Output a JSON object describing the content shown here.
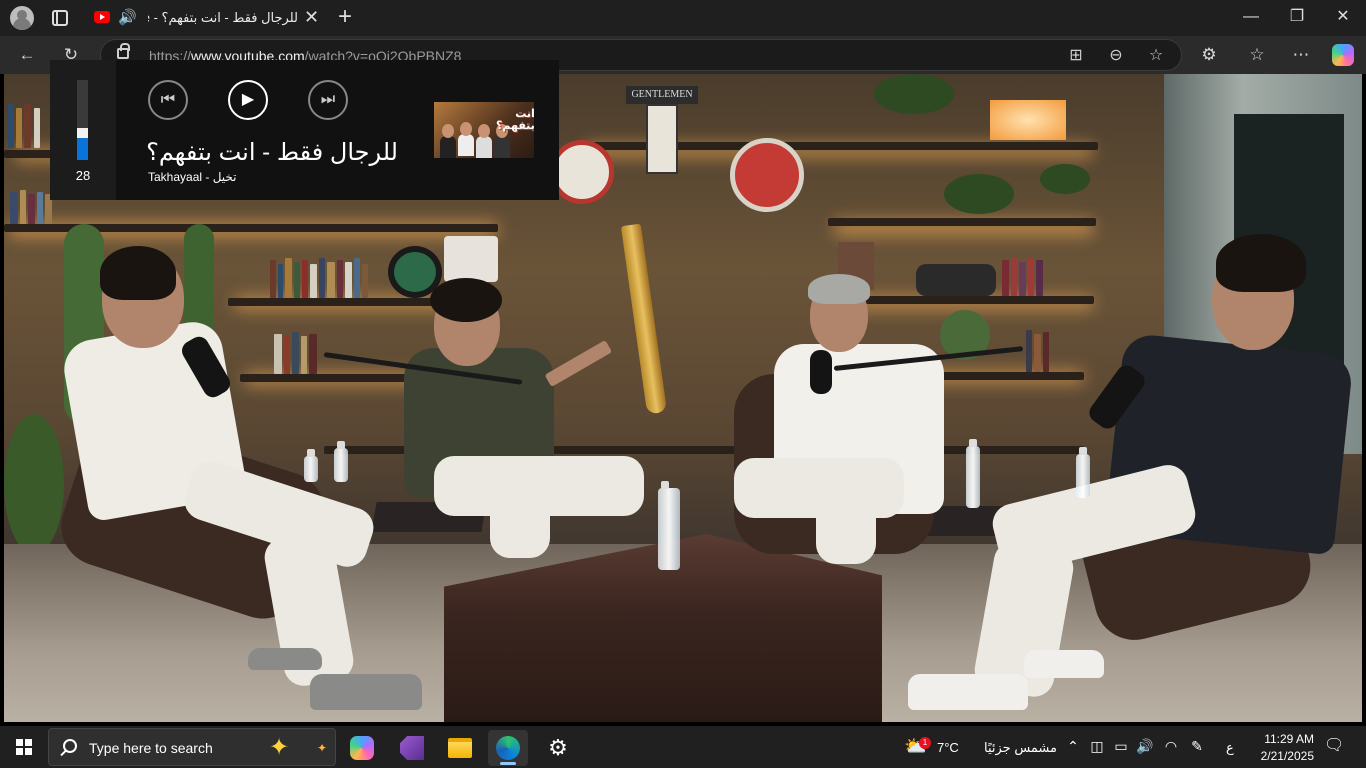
{
  "browser": {
    "tab_title": "للرجال فقط - انت بتفهم؟ - YouTube",
    "url_prefix": "https://",
    "url_domain": "www.youtube.com",
    "url_path": "/watch?v=oQi2QbPBNZ8",
    "tab_close": "✕",
    "new_tab": "+",
    "minimize": "—",
    "restore": "❐",
    "close": "✕",
    "back": "←",
    "refresh": "↻",
    "extensions": "⚙",
    "favorites": "☆",
    "more": "⋯"
  },
  "media_flyout": {
    "volume": 28,
    "volume_fraction": 0.28,
    "prev_glyph": "⏮",
    "play_glyph": "▶",
    "next_glyph": "⏭",
    "title": "للرجال فقط - انت بتفهم؟",
    "artist": "Takhayaal - تخيل",
    "thumbnail_text": "انت بتفهم؟"
  },
  "taskbar": {
    "search_placeholder": "Type here to search",
    "weather_temp": "7°C",
    "weather_desc": "مشمس جزئيًا",
    "weather_badge": "1",
    "language": "ع",
    "time": "11:29 AM",
    "date": "2/21/2025",
    "apps": [
      "copilot-app",
      "visual-studio-app",
      "file-explorer-app",
      "edge-app",
      "settings-app"
    ]
  },
  "colors": {
    "accent": "#0a73d9",
    "youtube_red": "#ff0000",
    "taskbar": "#202020",
    "flyout": "#1c1c1c"
  }
}
